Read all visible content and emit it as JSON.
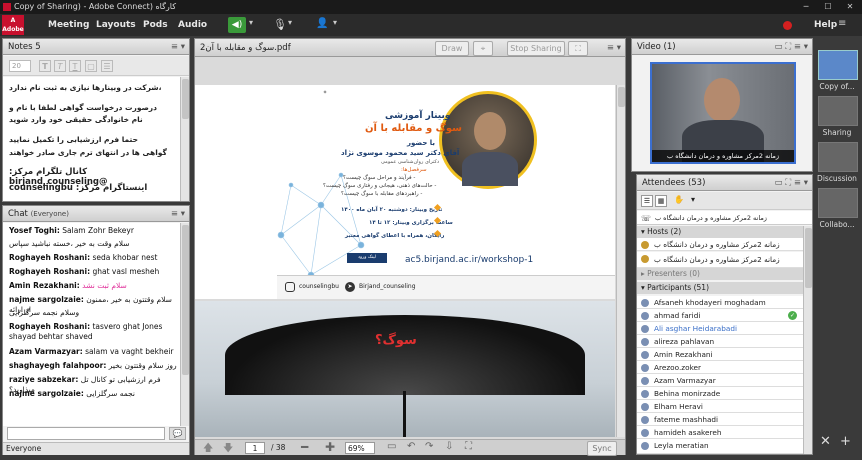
{
  "window": {
    "title": "Copy of Sharing) - Adobe Connect) کارگاه"
  },
  "menu": {
    "items": [
      "Meeting",
      "Layouts",
      "Pods",
      "Audio"
    ],
    "help": "Help"
  },
  "notes": {
    "title": "Notes",
    "count": "5",
    "font_size": "20",
    "lines": [
      "،شرکت در وبینارها نیازی به ثبت نام ندارد",
      "درصورت درخواست گواهی لطفا با نام و",
      "نام خانوادگی حقیقی خود وارد شوید",
      "حتما فرم ارزشیابی را تکمیل نمایید",
      "گواهی ها در انتهای ترم جاری صادر خواهند"
    ],
    "telegram": "کانال تلگرام مرکز: @birjand_counseling",
    "instagram": "اینستاگرام مرکز: counselingbu"
  },
  "chat": {
    "title": "Chat",
    "scope": "(Everyone)",
    "messages": [
      {
        "name": "Yosef Toghi:",
        "text": "Salam Zohr Bekeyr"
      },
      {
        "name": "",
        "text": "سلام وقت به خیر ،خسته نباشید سپاس"
      },
      {
        "name": "Roghayeh Roshani:",
        "text": "seda khobar nest"
      },
      {
        "name": "Roghayeh Roshani:",
        "text": "ghat vasl mesheh"
      },
      {
        "name": "Amin Rezakhani:",
        "text": "سلام ثبت نشد"
      },
      {
        "name": "najme sargolzaie:",
        "text": "سلام وقتتون به خیر ،ممنون از ارائه"
      },
      {
        "name": "",
        "text": "وسلام نجمه سرگلزایی"
      },
      {
        "name": "Roghayeh Roshani:",
        "text": "tasvero ghat Jones shayad behtar shaved"
      },
      {
        "name": "Azam Varmazyar:",
        "text": "salam va vaght bekheir"
      },
      {
        "name": "shaghayegh falahpoor:",
        "text": "روز سلام وقتتون بخیر"
      },
      {
        "name": "raziye sabzekar:",
        "text": "فرم ارزشیابی تو کانال تل میذارید؟"
      },
      {
        "name": "najme sargolzaie:",
        "text": "نجمه سرگلزایی"
      }
    ],
    "footer": "Everyone"
  },
  "share": {
    "title": "سوگ و مقابله با آن.pdf",
    "tab": "2",
    "draw": "Draw",
    "stop": "Stop Sharing",
    "page": "1",
    "total": "/ 38",
    "zoom": "69%",
    "sync": "Sync"
  },
  "slide": {
    "heading1": "وبینار آموزشی",
    "heading2": "سوگ و مقابله با آن",
    "with": "با حضور",
    "presenter": "آقای دکتر سید محمود موسوی نژاد",
    "presenter_sub": "دکترای روان‌شناسی عمومی",
    "topics_title": "سرفصل‌ها:",
    "topics": [
      "- فرآیند و مراحل سوگ چیست؟",
      "- حالت‌های ذهنی، هیجانی و رفتاری سوگ چیست؟",
      "- راهبردهای مقابله با سوگ چیست؟"
    ],
    "date": "تاریخ وبینار: دوشنبه ۲۰ آبان ماه ۱۴۰۰",
    "time": "ساعت برگزاری وبینار: ۱۲ تا ۱۴",
    "free": "رایگان، همراه با اعطای گواهی معتبر",
    "link": "ac5.birjand.ac.ir/workshop-1",
    "ig": "counselingbu",
    "tg": "Birjand_counseling",
    "reg": "لینک ورود",
    "sog": "سوگ؟"
  },
  "video": {
    "title": "Video",
    "count": "(1)",
    "caption": "زمانه 2مرکز مشاوره و درمان دانشگاه ب"
  },
  "attendees": {
    "title": "Attendees",
    "count": "(53)",
    "me": "زمانه 2مرکز مشاوره و درمان دانشگاه ب",
    "hosts_label": "Hosts (2)",
    "hosts": [
      "زمانه 2مرکز مشاوره و درمان دانشگاه ب",
      "زمانه 2مرکز مشاوره و درمان دانشگاه ب"
    ],
    "presenters_label": "Presenters (0)",
    "participants_label": "Participants (51)",
    "participants": [
      "Afsaneh khodayeri moghadam",
      "ahmad faridi",
      "Ali asghar Heidarabadi",
      "alireza pahlavan",
      "Amin Rezakhani",
      "Arezoo.zoker",
      "Azam Varmazyar",
      "Behina monirzade",
      "Elham Heravi",
      "fateme mashhadi",
      "hamideh asakereh",
      "Leyla meratian"
    ]
  },
  "layouts": [
    "Copy of...",
    "Sharing",
    "Discussion",
    "Collabo..."
  ],
  "colors": {
    "accent": "#5b88c9",
    "red_brand": "#c8102e",
    "mic_green": "#3a9a3a"
  }
}
